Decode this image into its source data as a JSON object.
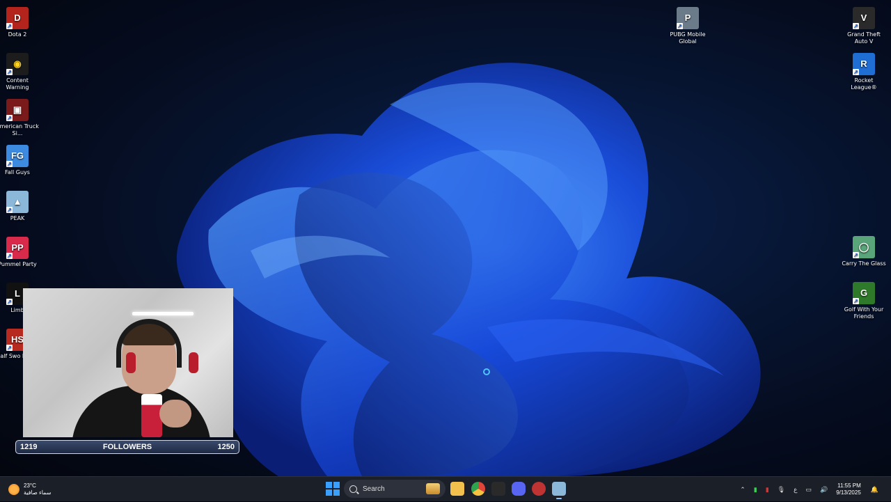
{
  "desktop_icons_left": [
    {
      "name": "dota2",
      "label": "Dota 2",
      "color": "#b3241c",
      "glyph": "D"
    },
    {
      "name": "content-warning",
      "label": "Content Warning",
      "color": "#1c1c1c",
      "glyph": "◉"
    },
    {
      "name": "american-truck",
      "label": "American Truck Si...",
      "color": "#7a1a1a",
      "glyph": "▣"
    },
    {
      "name": "fall-guys",
      "label": "Fall Guys",
      "color": "#3d8be0",
      "glyph": "FG"
    },
    {
      "name": "peak",
      "label": "PEAK",
      "color": "#8bb7d8",
      "glyph": "▲"
    },
    {
      "name": "pummel-party",
      "label": "Pummel Party",
      "color": "#d82a4a",
      "glyph": "PP"
    },
    {
      "name": "limbo",
      "label": "Limb",
      "color": "#111111",
      "glyph": "L"
    },
    {
      "name": "half-sword",
      "label": "Half Swo Demo",
      "color": "#b72a20",
      "glyph": "HS"
    }
  ],
  "desktop_icons_right": [
    {
      "name": "pubg-mobile",
      "label": "PUBG Mobile Global",
      "color": "#6b7b8a",
      "glyph": "P"
    },
    {
      "name": "gta-v",
      "label": "Grand Theft Auto V",
      "color": "#2a2a2a",
      "glyph": "V"
    },
    {
      "name": "rocket-league",
      "label": "Rocket League®",
      "color": "#1f6ed4",
      "glyph": "R"
    },
    {
      "name": "carry-the-glass",
      "label": "Carry The Glass",
      "color": "#5aa47a",
      "glyph": "◯"
    },
    {
      "name": "golf-with-friends",
      "label": "Golf With Your Friends",
      "color": "#2f7a2a",
      "glyph": "G"
    }
  ],
  "followers": {
    "current": "1219",
    "label": "FOLLOWERS",
    "goal": "1250",
    "progress": 0.0
  },
  "taskbar": {
    "weather_temp": "23°C",
    "weather_desc": "سماء صافية",
    "search_placeholder": "Search",
    "apps": [
      {
        "name": "file-explorer",
        "color": "#f2c04c"
      },
      {
        "name": "chrome",
        "color": "#e0453a"
      },
      {
        "name": "download-tool",
        "color": "#2a2a2a"
      },
      {
        "name": "discord",
        "color": "#5865f2"
      },
      {
        "name": "game-app",
        "color": "#c03333"
      },
      {
        "name": "peak-app",
        "color": "#8bb7d8",
        "active": true
      }
    ],
    "tray_lang": "ع",
    "time": "11:55 PM",
    "date": "9/13/2025"
  }
}
